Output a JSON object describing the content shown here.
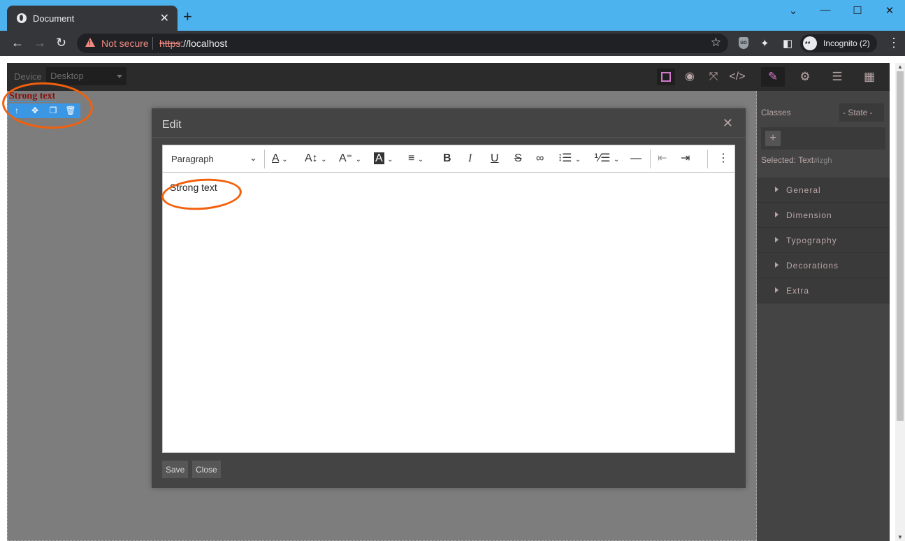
{
  "browser": {
    "tab_title": "Document",
    "tab_close": "✕",
    "new_tab": "+",
    "window_controls": {
      "minimize": "—",
      "restore": "☐",
      "close": "✕",
      "tab_search": "⌄"
    },
    "not_secure": "Not secure",
    "url_scheme": "https",
    "url_rest": "://localhost",
    "incognito_label": "Incognito (2)",
    "icons": [
      "back-arrow-icon",
      "forward-arrow-icon",
      "reload-icon",
      "warning-icon",
      "star-icon",
      "ublock-shield-icon",
      "extensions-puzzle-icon",
      "side-panel-icon",
      "incognito-icon",
      "more-vert-icon"
    ]
  },
  "editor": {
    "device_label": "Device",
    "device_value": "Desktop",
    "canvas_text": "Strong text",
    "toolbar_icons": [
      "square-outline-icon",
      "eye-icon",
      "fullscreen-icon",
      "code-icon"
    ],
    "panel_icons": [
      "paint-brush-icon",
      "gear-icon",
      "layers-icon",
      "blocks-icon"
    ],
    "right_panel": {
      "classes_label": "Classes",
      "state_label": "- State -",
      "selected_label": "Selected:",
      "selected_name": "Text",
      "selected_id": "#izgh",
      "sectors": [
        "General",
        "Dimension",
        "Typography",
        "Decorations",
        "Extra"
      ]
    }
  },
  "modal": {
    "title": "Edit",
    "close": "✕",
    "format_select": "Paragraph",
    "content": "Strong text",
    "save_label": "Save",
    "close_label": "Close"
  },
  "colors": {
    "chrome_blue": "#4db3ef",
    "accent_pink": "#d278c9",
    "selection_blue": "#3b97e3",
    "annotation_orange": "#f2600c",
    "warning_red": "#f28b82"
  }
}
